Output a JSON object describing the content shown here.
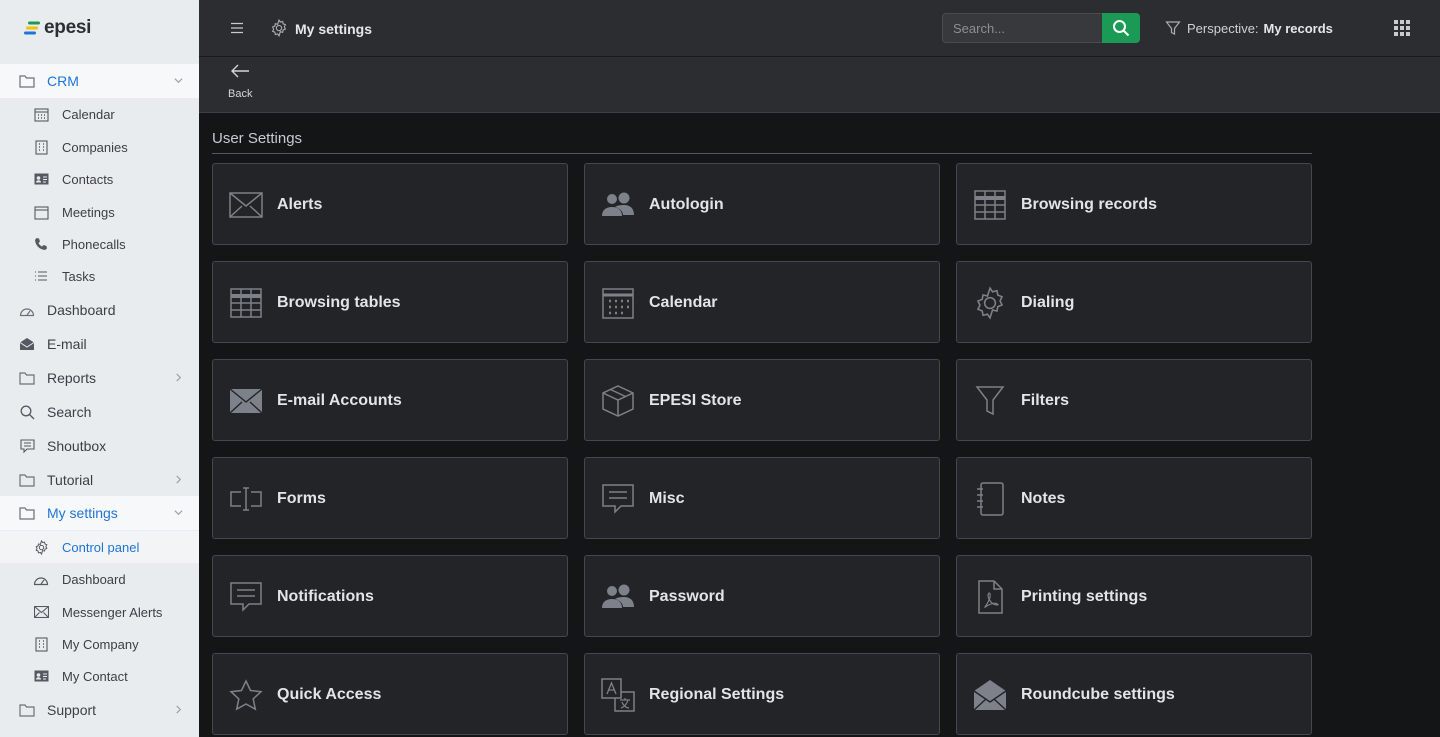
{
  "logo": {
    "text": "epesi"
  },
  "sidebar": {
    "items": [
      {
        "label": "CRM",
        "icon": "folder-icon",
        "level": "top",
        "state": "open"
      },
      {
        "label": "Calendar",
        "icon": "calendar-icon",
        "level": "sub"
      },
      {
        "label": "Companies",
        "icon": "building-icon",
        "level": "sub"
      },
      {
        "label": "Contacts",
        "icon": "id-card-icon",
        "level": "sub"
      },
      {
        "label": "Meetings",
        "icon": "calendar-blank-icon",
        "level": "sub"
      },
      {
        "label": "Phonecalls",
        "icon": "phone-icon",
        "level": "sub"
      },
      {
        "label": "Tasks",
        "icon": "list-icon",
        "level": "sub"
      },
      {
        "label": "Dashboard",
        "icon": "dashboard-icon",
        "level": "top"
      },
      {
        "label": "E-mail",
        "icon": "envelope-open-icon",
        "level": "top"
      },
      {
        "label": "Reports",
        "icon": "folder-icon",
        "level": "top",
        "state": "closed"
      },
      {
        "label": "Search",
        "icon": "search-icon",
        "level": "top"
      },
      {
        "label": "Shoutbox",
        "icon": "chat-icon",
        "level": "top"
      },
      {
        "label": "Tutorial",
        "icon": "folder-icon",
        "level": "top",
        "state": "closed"
      },
      {
        "label": "My settings",
        "icon": "folder-icon",
        "level": "top",
        "state": "open"
      },
      {
        "label": "Control panel",
        "icon": "gear-icon",
        "level": "sub",
        "active": true
      },
      {
        "label": "Dashboard",
        "icon": "dashboard-icon",
        "level": "sub"
      },
      {
        "label": "Messenger Alerts",
        "icon": "envelope-icon",
        "level": "sub"
      },
      {
        "label": "My Company",
        "icon": "building-icon",
        "level": "sub"
      },
      {
        "label": "My Contact",
        "icon": "id-card-icon",
        "level": "sub"
      },
      {
        "label": "Support",
        "icon": "folder-icon",
        "level": "top",
        "state": "closed"
      }
    ]
  },
  "topbar": {
    "title": "My settings",
    "search_placeholder": "Search...",
    "perspective_label": "Perspective:",
    "perspective_value": "My records"
  },
  "actionbar": {
    "back_label": "Back"
  },
  "content": {
    "section_title": "User Settings",
    "tiles": [
      {
        "label": "Alerts",
        "icon": "envelope-icon"
      },
      {
        "label": "Autologin",
        "icon": "users-icon"
      },
      {
        "label": "Browsing records",
        "icon": "table-icon"
      },
      {
        "label": "Browsing tables",
        "icon": "table-icon"
      },
      {
        "label": "Calendar",
        "icon": "calendar-icon"
      },
      {
        "label": "Dialing",
        "icon": "gear-icon"
      },
      {
        "label": "E-mail Accounts",
        "icon": "envelope-solid-icon"
      },
      {
        "label": "EPESI Store",
        "icon": "box-icon"
      },
      {
        "label": "Filters",
        "icon": "filter-icon"
      },
      {
        "label": "Forms",
        "icon": "text-cursor-icon"
      },
      {
        "label": "Misc",
        "icon": "comment-icon"
      },
      {
        "label": "Notes",
        "icon": "notebook-icon"
      },
      {
        "label": "Notifications",
        "icon": "comment-icon"
      },
      {
        "label": "Password",
        "icon": "users-icon"
      },
      {
        "label": "Printing settings",
        "icon": "pdf-file-icon"
      },
      {
        "label": "Quick Access",
        "icon": "star-icon"
      },
      {
        "label": "Regional Settings",
        "icon": "language-icon"
      },
      {
        "label": "Roundcube settings",
        "icon": "envelope-open-icon"
      }
    ]
  },
  "colors": {
    "accent": "#1f74d6",
    "search_button": "#1b9a55",
    "logo_green": "#1b9a55",
    "logo_yellow": "#f2c200",
    "logo_blue": "#1f74d6"
  }
}
